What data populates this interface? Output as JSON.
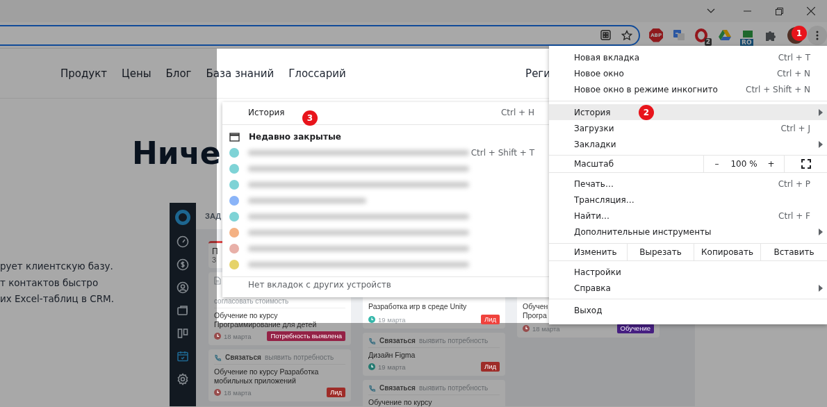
{
  "toolbar": {
    "extensions": [
      {
        "kind": "abp",
        "label": "ABP"
      },
      {
        "kind": "translate"
      },
      {
        "kind": "opera",
        "badge": "2"
      },
      {
        "kind": "drive"
      },
      {
        "kind": "ro",
        "badge": "RO"
      },
      {
        "kind": "puzzle"
      }
    ]
  },
  "page": {
    "nav": [
      "Продукт",
      "Цены",
      "Блог",
      "База знаний",
      "Глоссарий"
    ],
    "nav_cut": "Реги",
    "heading": "Ниче",
    "paragraph_lines": [
      "рует клиентскую базу.",
      "т контактов быстро",
      "их Excel-таблиц в CRM."
    ]
  },
  "app_preview": {
    "header": "ЗАД",
    "sidebar": [
      {
        "kind": "gauge",
        "selected": false
      },
      {
        "kind": "dollar",
        "selected": false
      },
      {
        "kind": "user",
        "selected": false
      },
      {
        "kind": "folder",
        "selected": false
      },
      {
        "kind": "columns",
        "selected": false
      },
      {
        "kind": "calendar",
        "selected": true
      },
      {
        "kind": "gear",
        "selected": false
      }
    ],
    "columns": [
      {
        "cards": [
          {
            "kind": "cut",
            "lines": [
              "П",
              "З"
            ]
          },
          {
            "kind": "doc",
            "note": "согласовать стоимость",
            "title_lines": [
              "Обучение по курсу",
              "Программирование для детей"
            ],
            "date": {
              "text": "18 марта",
              "color": "#974c4c"
            },
            "tag": {
              "label": "Потребность выявлена",
              "color": "#942246"
            }
          },
          {
            "kind": "call",
            "type_label": "Связаться",
            "action": "выявить потребность",
            "title_lines": [
              "Обучение по курсу Разработка",
              "мобильных приложений"
            ],
            "date": {
              "text": "18 марта",
              "color": "#974c4c"
            },
            "tag": {
              "label": "Лид",
              "color": "#9e2c28"
            }
          }
        ]
      },
      {
        "cards": [
          {
            "kind": "plain",
            "title_lines": [
              "Разработка игр в среде Unity"
            ],
            "date": {
              "text": "19 марта",
              "color": "#35b7aa"
            },
            "tag": {
              "label": "Лид",
              "color": "#f0433d"
            }
          },
          {
            "kind": "call",
            "type_label": "Связаться",
            "action": "выявить потребность",
            "title_lines": [
              "Дизайн Figma"
            ],
            "date": {
              "text": "19 марта",
              "color": "#237970"
            },
            "tag": {
              "label": "Лид",
              "color": "#9e2c28"
            }
          },
          {
            "kind": "call",
            "type_label": "Связаться",
            "action": "выявить потребность",
            "title_lines": [
              "Обучение по курсу"
            ]
          }
        ]
      },
      {
        "cards": [
          {
            "kind": "plain",
            "title_lines": [
              "Обучен",
              "Програ"
            ],
            "date": {
              "text": "18 марта",
              "color": "#974c4c"
            },
            "tag": {
              "label": "Обучение",
              "color": "#461f81"
            }
          }
        ]
      }
    ]
  },
  "history_submenu": {
    "header": {
      "label": "История",
      "shortcut": "Ctrl + H"
    },
    "section_title": "Недавно закрытые",
    "entries": [
      {
        "color": "#7ed3d6",
        "shortcut": "Ctrl + Shift + T"
      },
      {
        "color": "#7ed3d6"
      },
      {
        "color": "#7ed3d6"
      },
      {
        "color": "#8ab4f8"
      },
      {
        "color": "#7ed3d6"
      },
      {
        "color": "#f4b183"
      },
      {
        "color": "#e8b0a8"
      },
      {
        "color": "#e6d36a"
      }
    ],
    "footer": "Нет вкладок с других устройств"
  },
  "main_menu": {
    "items": [
      {
        "kind": "item",
        "label": "Новая вкладка",
        "shortcut": "Ctrl + T",
        "submenu": false,
        "highlighted": false
      },
      {
        "kind": "item",
        "label": "Новое окно",
        "shortcut": "Ctrl + N",
        "submenu": false,
        "highlighted": false
      },
      {
        "kind": "item",
        "label": "Новое окно в режиме инкогнито",
        "shortcut": "Ctrl + Shift + N",
        "submenu": false,
        "highlighted": false
      },
      {
        "kind": "separator"
      },
      {
        "kind": "item",
        "label": "История",
        "submenu": true,
        "highlighted": true
      },
      {
        "kind": "item",
        "label": "Загрузки",
        "shortcut": "Ctrl + J",
        "submenu": false,
        "highlighted": false
      },
      {
        "kind": "item",
        "label": "Закладки",
        "submenu": true,
        "highlighted": false
      },
      {
        "kind": "separator"
      },
      {
        "kind": "zoom",
        "label": "Масштаб",
        "minus": "–",
        "value": "100 %",
        "plus": "+"
      },
      {
        "kind": "separator"
      },
      {
        "kind": "item",
        "label": "Печать…",
        "shortcut": "Ctrl + P",
        "submenu": false,
        "highlighted": false
      },
      {
        "kind": "item",
        "label": "Трансляция…",
        "submenu": false,
        "highlighted": false
      },
      {
        "kind": "item",
        "label": "Найти…",
        "shortcut": "Ctrl + F",
        "submenu": false,
        "highlighted": false
      },
      {
        "kind": "item",
        "label": "Дополнительные инструменты",
        "submenu": true,
        "highlighted": false
      },
      {
        "kind": "separator"
      },
      {
        "kind": "edit",
        "label": "Изменить",
        "actions": [
          "Вырезать",
          "Копировать",
          "Вставить"
        ]
      },
      {
        "kind": "separator"
      },
      {
        "kind": "item",
        "label": "Настройки",
        "submenu": false,
        "highlighted": false
      },
      {
        "kind": "item",
        "label": "Справка",
        "submenu": true,
        "highlighted": false
      },
      {
        "kind": "separator"
      },
      {
        "kind": "item",
        "label": "Выход",
        "submenu": false,
        "highlighted": false
      }
    ]
  },
  "markers": [
    {
      "label": "1"
    },
    {
      "label": "2"
    },
    {
      "label": "3"
    }
  ]
}
